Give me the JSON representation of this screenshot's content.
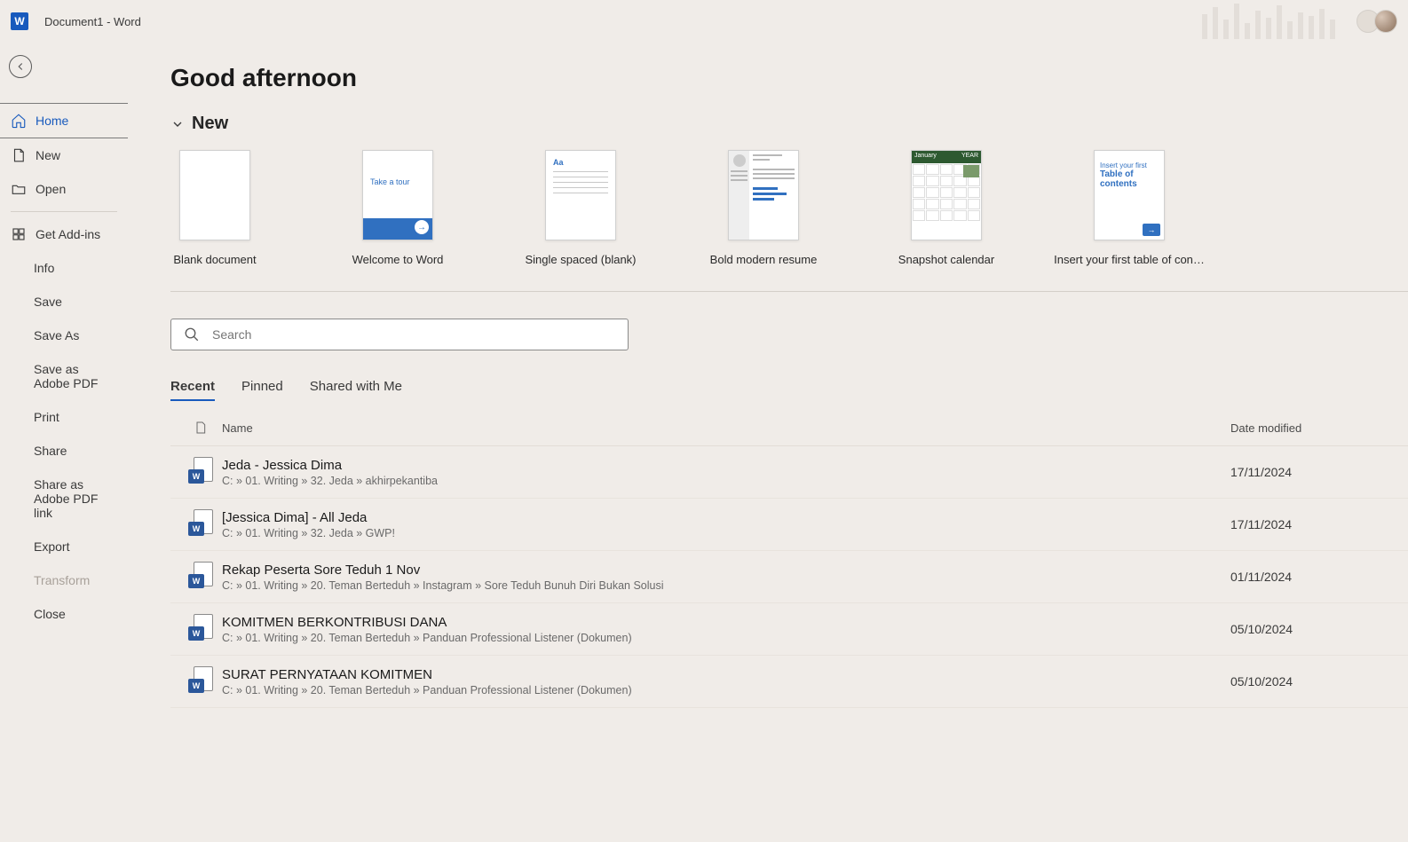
{
  "titlebar": {
    "title": "Document1  -  Word"
  },
  "sidebar": {
    "home": "Home",
    "new": "New",
    "open": "Open",
    "getAddins": "Get Add-ins",
    "info": "Info",
    "save": "Save",
    "saveAs": "Save As",
    "saveAdobe": "Save as Adobe PDF",
    "print": "Print",
    "share": "Share",
    "shareAdobe": "Share as Adobe PDF link",
    "export": "Export",
    "transform": "Transform",
    "close": "Close"
  },
  "content": {
    "greeting": "Good afternoon",
    "newHeader": "New",
    "searchPlaceholder": "Search",
    "templates": [
      {
        "label": "Blank document"
      },
      {
        "label": "Welcome to Word",
        "tour": "Take a tour"
      },
      {
        "label": "Single spaced (blank)",
        "aa": "Aa"
      },
      {
        "label": "Bold modern resume"
      },
      {
        "label": "Snapshot calendar",
        "month": "January",
        "year": "YEAR"
      },
      {
        "label": "Insert your first table of con…",
        "line1": "Insert your first",
        "line2": "Table of",
        "line3": "contents"
      }
    ],
    "tabs": {
      "recent": "Recent",
      "pinned": "Pinned",
      "shared": "Shared with Me"
    },
    "columns": {
      "name": "Name",
      "date": "Date modified"
    },
    "files": [
      {
        "title": "Jeda - Jessica Dima",
        "path": "C: » 01. Writing » 32. Jeda » akhirpekantiba",
        "date": "17/11/2024"
      },
      {
        "title": "[Jessica Dima] - All Jeda",
        "path": "C: » 01. Writing » 32. Jeda » GWP!",
        "date": "17/11/2024"
      },
      {
        "title": "Rekap Peserta Sore Teduh 1 Nov",
        "path": "C: » 01. Writing » 20. Teman Berteduh » Instagram » Sore Teduh Bunuh Diri Bukan Solusi",
        "date": "01/11/2024"
      },
      {
        "title": "KOMITMEN BERKONTRIBUSI DANA",
        "path": "C: » 01. Writing » 20. Teman Berteduh » Panduan Professional Listener (Dokumen)",
        "date": "05/10/2024"
      },
      {
        "title": "SURAT PERNYATAAN KOMITMEN",
        "path": "C: » 01. Writing » 20. Teman Berteduh » Panduan Professional Listener (Dokumen)",
        "date": "05/10/2024"
      }
    ]
  }
}
